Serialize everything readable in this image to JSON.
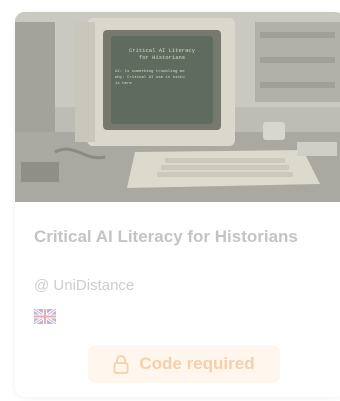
{
  "course": {
    "title": "Critical AI Literacy for Historians",
    "provider": "@ UniDistance",
    "language_icon": "uk-flag-icon"
  },
  "thumbnail": {
    "screen_heading": "Critical AI Literacy\nfor Historians",
    "screen_text": "AI: Is something troubling me\nwhy: Critical AI use in histo\nis here"
  },
  "action": {
    "label": "Code required",
    "icon": "lock-icon",
    "text_color": "#f7cfa8",
    "bg_color": "#fff6ee"
  }
}
